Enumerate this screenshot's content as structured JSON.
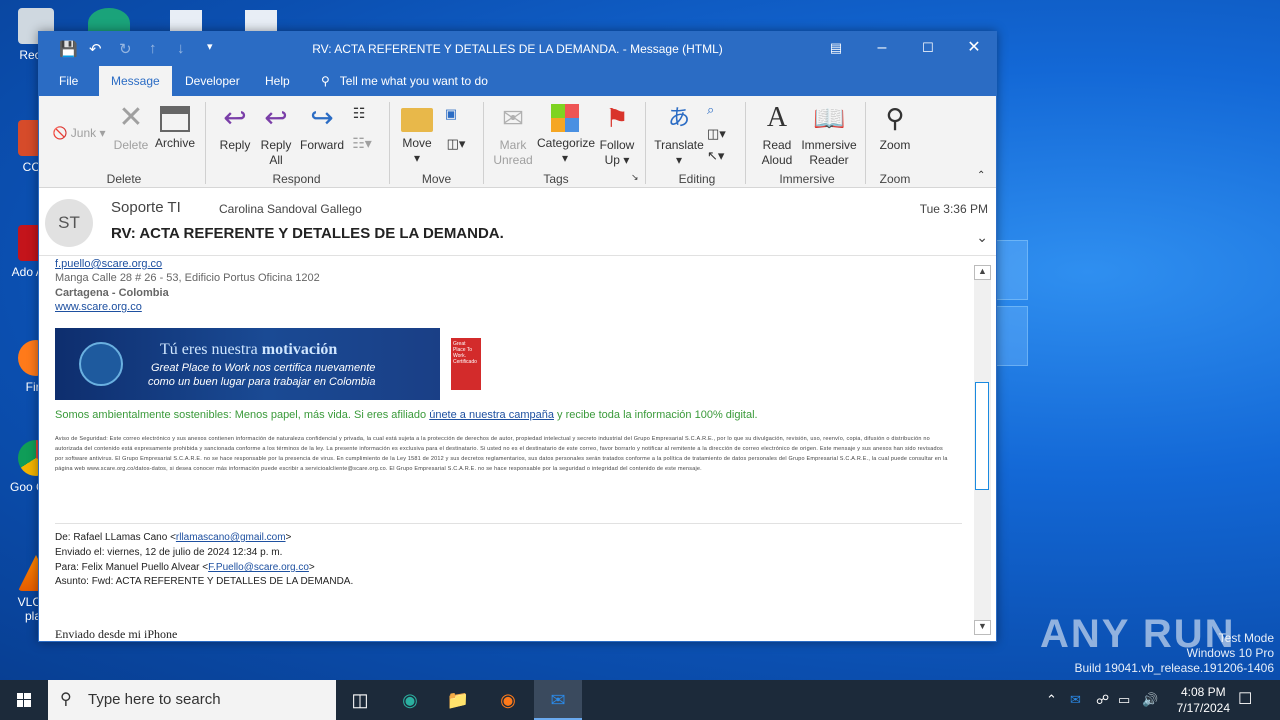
{
  "window": {
    "title": "RV: ACTA REFERENTE Y DETALLES DE LA DEMANDA.  -  Message (HTML)"
  },
  "menu": {
    "tabs": [
      "File",
      "Message",
      "Developer",
      "Help"
    ],
    "tell_me": "Tell me what you want to do"
  },
  "ribbon": {
    "delete_group": {
      "junk": "Junk",
      "delete": "Delete",
      "archive": "Archive",
      "label": "Delete"
    },
    "respond_group": {
      "reply": "Reply",
      "reply_all_1": "Reply",
      "reply_all_2": "All",
      "forward": "Forward",
      "label": "Respond"
    },
    "move_group": {
      "move": "Move",
      "label": "Move"
    },
    "tags_group": {
      "mark_unread_1": "Mark",
      "mark_unread_2": "Unread",
      "categorize": "Categorize",
      "follow_up_1": "Follow",
      "follow_up_2": "Up",
      "label": "Tags"
    },
    "editing_group": {
      "translate": "Translate",
      "label": "Editing"
    },
    "immersive_group": {
      "read_aloud_1": "Read",
      "read_aloud_2": "Aloud",
      "immersive_reader_1": "Immersive",
      "immersive_reader_2": "Reader",
      "label": "Immersive"
    },
    "zoom_group": {
      "zoom": "Zoom",
      "label": "Zoom"
    }
  },
  "message": {
    "avatar_initials": "ST",
    "sender": "Soporte TI",
    "recipient": "Carolina Sandoval Gallego",
    "time": "Tue 3:36 PM",
    "subject": "RV: ACTA REFERENTE Y DETALLES DE LA DEMANDA."
  },
  "body": {
    "email_partial": "f.puello@scare.org.co",
    "address": "Manga Calle 28 # 26 - 53, Edificio Portus Oficina 1202",
    "city": "Cartagena - Colombia",
    "website": "www.scare.org.co",
    "banner_line1_a": "Tú eres nuestra ",
    "banner_line1_b": "motivación",
    "banner_line2": "Great Place to Work nos certifica nuevamente",
    "banner_line3": "como un buen lugar para trabajar en Colombia",
    "badge": "Great Place To Work. Certificado",
    "green_text_a": "Somos ambientalmente sostenibles: Menos papel, más vida. Si eres afiliado ",
    "green_link": "únete a nuestra campaña",
    "green_text_b": " y recibe toda la información 100% digital.",
    "security_notice": "Aviso de Seguridad: Este correo electrónico y sus anexos contienen información de naturaleza confidencial y privada, la cual está sujeta a la protección de derechos de autor, propiedad intelectual y secreto industrial del Grupo Empresarial S.C.A.R.E., por lo que su divulgación, revisión, uso, reenvío, copia, difusión o distribución no autorizada del contenido está expresamente prohibida y sancionada conforme a los términos de la ley. La presente información es exclusiva para el destinatario. Si usted no es el destinatario de este correo, favor borrarlo y notificar al remitente a la dirección de correo electrónico de origen. Este mensaje y sus anexos han sido revisados por software antivirus. El Grupo Empresarial S.C.A.R.E. no se hace responsable por la presencia de virus. En cumplimiento de la Ley 1581 de 2012 y sus decretos reglamentarios, sus datos personales serán tratados conforme a la política de tratamiento de datos personales del Grupo Empresarial S.C.A.R.E., la cual puede consultar en la página web www.scare.org.co/datos-datos, si desea conocer más información puede escribir a servicioalcliente@scare.org.co. El Grupo Empresarial S.C.A.R.E. no se hace responsable por la seguridad o integridad del contenido de este mensaje.",
    "from_label": "De: Rafael LLamas Cano <",
    "from_email": "rllamascano@gmail.com",
    "sent": "Enviado el: viernes, 12 de julio de 2024 12:34 p. m.",
    "to_label": "Para: Felix Manuel Puello Alvear <",
    "to_email": "F.Puello@scare.org.co",
    "subject_fwd": "Asunto: Fwd: ACTA REFERENTE Y DETALLES DE LA DEMANDA.",
    "iphone": "Enviado desde mi iPhone"
  },
  "desktop": {
    "icons": [
      "Recyc",
      "CCle",
      "Ado Acro",
      "Fire",
      "Goo Chro",
      "VLC m play"
    ],
    "watermark_line1": "Test Mode",
    "watermark_line2": "Windows 10 Pro",
    "watermark_line3": "Build 19041.vb_release.191206-1406",
    "anyrun": "ANY RUN"
  },
  "taskbar": {
    "search_placeholder": "Type here to search",
    "time": "4:08 PM",
    "date": "7/17/2024"
  },
  "colors": {
    "accent": "#2b6cc4",
    "link": "#1e50a0",
    "green": "#3a9a3a"
  }
}
